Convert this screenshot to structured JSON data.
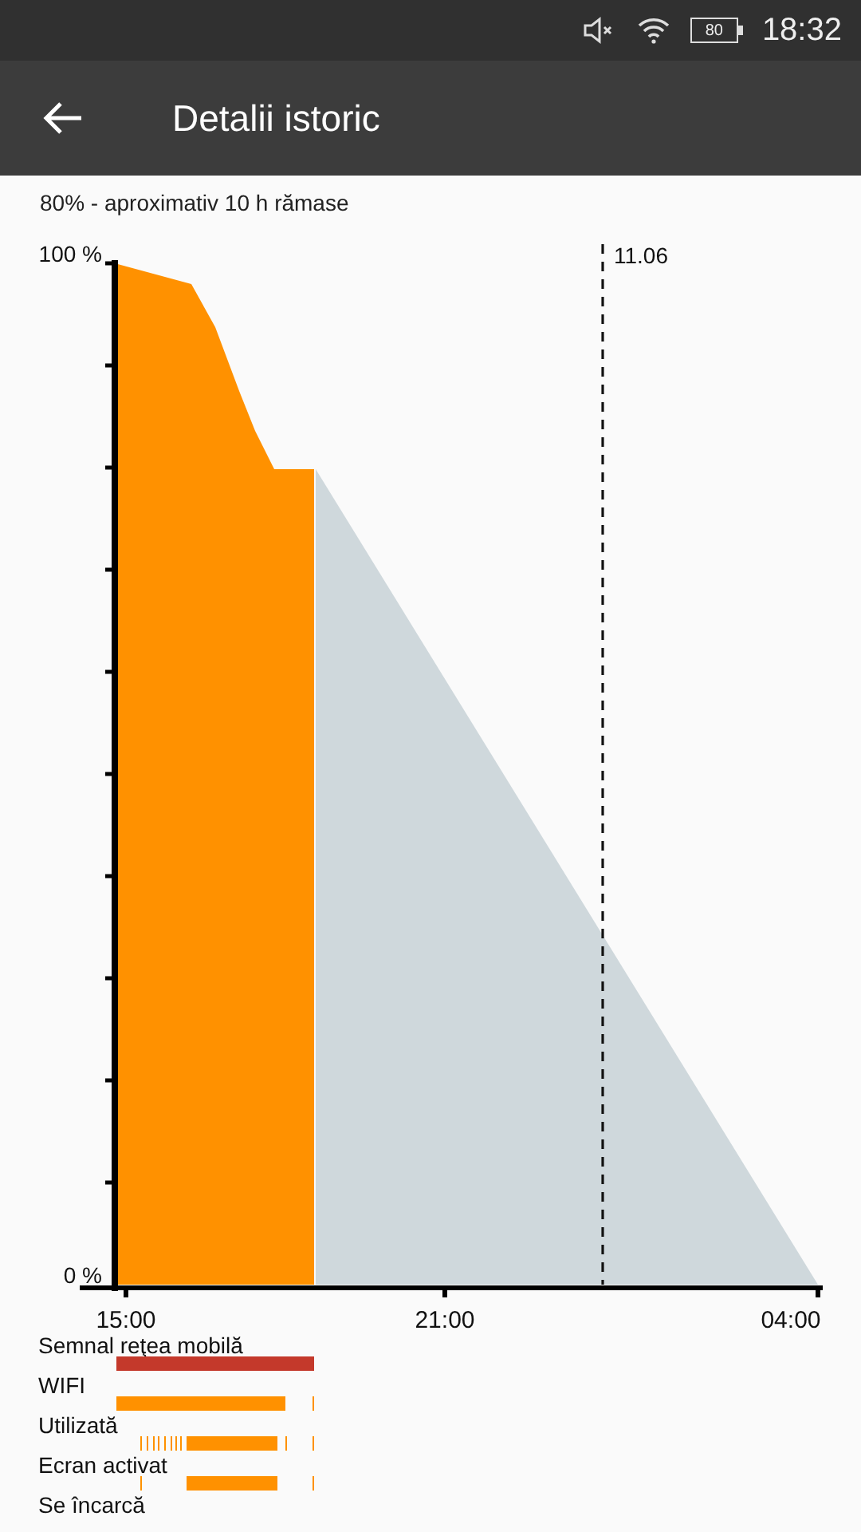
{
  "status_bar": {
    "battery": "80",
    "time": "18:32"
  },
  "toolbar": {
    "title": "Detalii istoric"
  },
  "summary": "80% - aproximativ 10 h rămase",
  "history_chart": {
    "y_labels": [
      "100 %",
      "0 %"
    ],
    "x_labels": [
      "15:00",
      "21:00",
      "04:00"
    ],
    "date_marker": "11.06"
  },
  "activity": [
    {
      "label": "Semnal reţea mobilă",
      "color": "#c4392b"
    },
    {
      "label": "WIFI",
      "color": "#ff9100"
    },
    {
      "label": "Utilizată",
      "color": "#ff9100"
    },
    {
      "label": "Ecran activat",
      "color": "#ff9100"
    },
    {
      "label": "Se încarcă"
    }
  ]
}
